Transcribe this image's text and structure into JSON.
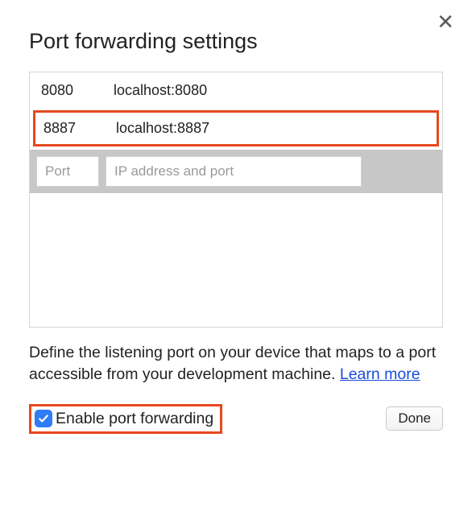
{
  "title": "Port forwarding settings",
  "rows": [
    {
      "port": "8080",
      "address": "localhost:8080",
      "highlighted": false
    },
    {
      "port": "8887",
      "address": "localhost:8887",
      "highlighted": true
    }
  ],
  "inputs": {
    "port_placeholder": "Port",
    "address_placeholder": "IP address and port"
  },
  "description": "Define the listening port on your device that maps to a port accessible from your development machine. ",
  "learn_more_label": "Learn more",
  "checkbox": {
    "label": "Enable port forwarding",
    "checked": true
  },
  "done_label": "Done"
}
